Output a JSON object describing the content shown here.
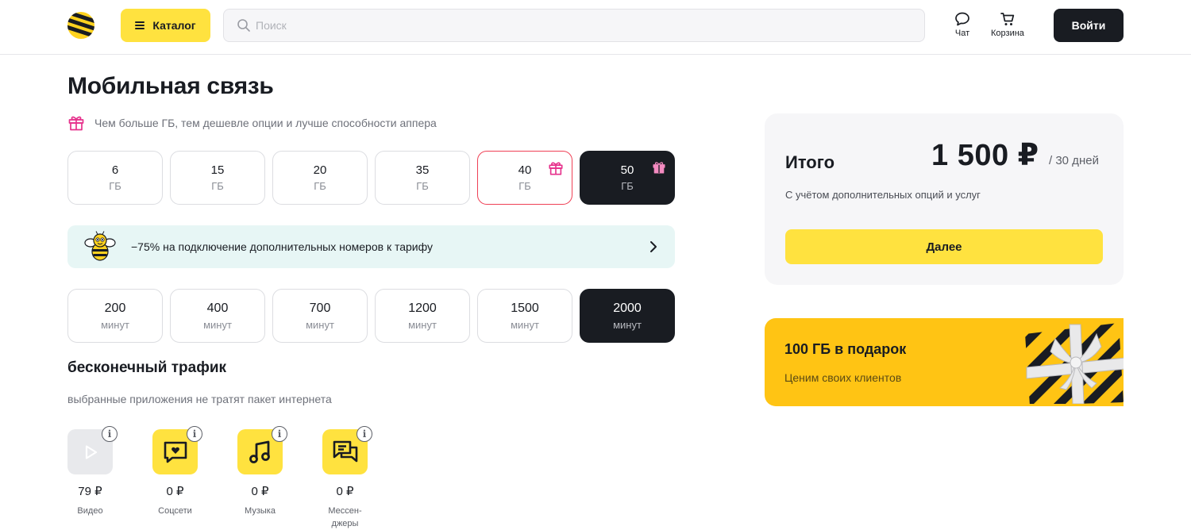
{
  "header": {
    "catalog_label": "Каталог",
    "search_placeholder": "Поиск",
    "chat_label": "Чат",
    "cart_label": "Корзина",
    "login_label": "Войти"
  },
  "page": {
    "title": "Мобильная связь",
    "hint": "Чем больше ГБ, тем дешевле опции и лучше способности аппера"
  },
  "data_options": [
    {
      "value": "6",
      "unit": "ГБ"
    },
    {
      "value": "15",
      "unit": "ГБ"
    },
    {
      "value": "20",
      "unit": "ГБ"
    },
    {
      "value": "35",
      "unit": "ГБ"
    },
    {
      "value": "40",
      "unit": "ГБ"
    },
    {
      "value": "50",
      "unit": "ГБ"
    }
  ],
  "promo": {
    "text": "−75% на подключение дополнительных номеров к тарифу"
  },
  "minute_options": [
    {
      "value": "200",
      "unit": "минут"
    },
    {
      "value": "400",
      "unit": "минут"
    },
    {
      "value": "700",
      "unit": "минут"
    },
    {
      "value": "1200",
      "unit": "минут"
    },
    {
      "value": "1500",
      "unit": "минут"
    },
    {
      "value": "2000",
      "unit": "минут"
    }
  ],
  "unlimited": {
    "title": "бесконечный трафик",
    "subtitle": "выбранные приложения не тратят пакет интернета",
    "apps": [
      {
        "price": "79 ₽",
        "label": "Видео",
        "icon": "play-icon"
      },
      {
        "price": "0 ₽",
        "label": "Соцсети",
        "icon": "chat-heart-icon"
      },
      {
        "price": "0 ₽",
        "label": "Музыка",
        "icon": "music-note-icon"
      },
      {
        "price": "0 ₽",
        "label": "Мессен-джеры",
        "icon": "messages-icon"
      }
    ]
  },
  "summary": {
    "label": "Итого",
    "price": "1 500 ₽",
    "period": "/ 30 дней",
    "note": "С учётом дополнительных опций и услуг",
    "next_label": "Далее"
  },
  "gift_banner": {
    "title": "100 ГБ в подарок",
    "subtitle": "Ценим своих клиентов"
  },
  "colors": {
    "brand_yellow": "#ffe23f",
    "dark": "#191c22",
    "highlight_border": "#ef4055",
    "gift_pink": "#e6328c",
    "promo_bg": "#e7f6f5",
    "banner_yellow": "#ffc414"
  }
}
